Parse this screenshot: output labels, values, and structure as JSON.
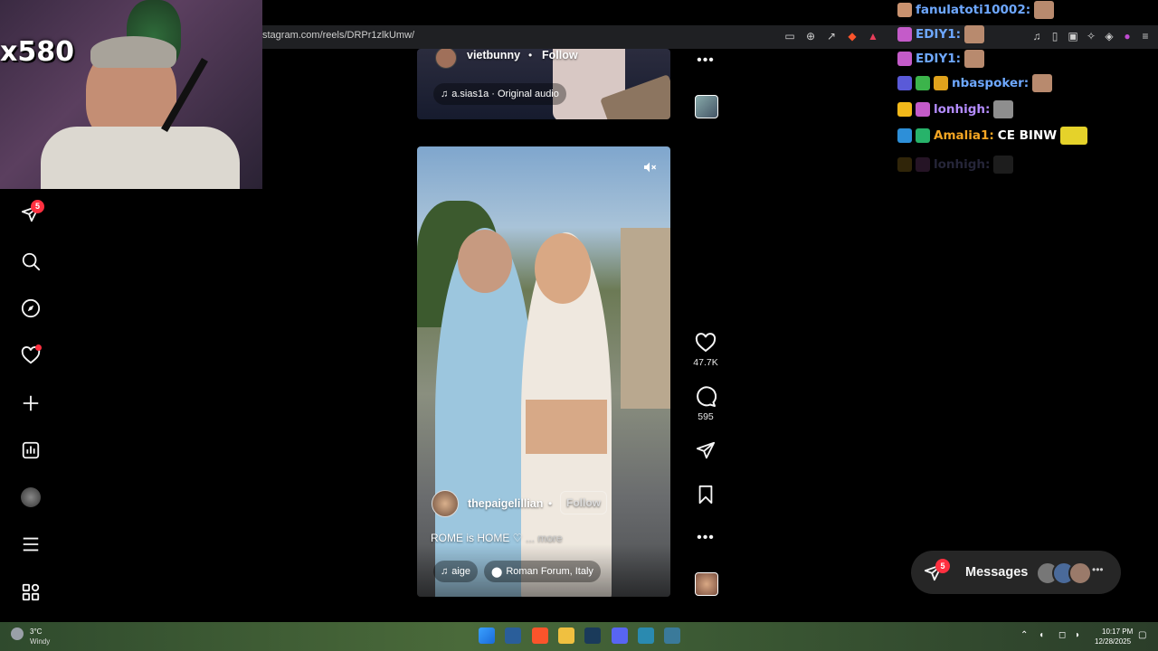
{
  "browser": {
    "url": "stagram.com/reels/DRPr1zlkUmw/"
  },
  "webcam": {
    "overlay_text": "x580"
  },
  "nav": {
    "direct_badge": "5"
  },
  "reel_top": {
    "username": "vietbunny",
    "follow_label": "Follow",
    "audio": "a.sias1a · Original audio"
  },
  "reel_main": {
    "username": "thepaigelillian",
    "follow_label": "Follow",
    "caption": "ROME is HOME ♡",
    "more_label": "... more",
    "audio": "aige",
    "location": "Roman Forum, Italy",
    "likes": "47.7K",
    "comments": "595"
  },
  "chat": [
    {
      "user": "fanulatoti10002:",
      "color": "#6ea8ff"
    },
    {
      "user": "EDIY1:",
      "color": "#6ea8ff"
    },
    {
      "user": "EDIY1:",
      "color": "#6ea8ff"
    },
    {
      "user": "nbaspoker:",
      "color": "#6ea8ff"
    },
    {
      "user": "lonhigh:",
      "color": "#b48cff"
    },
    {
      "user": "Amalia1:",
      "color": "#f5a623",
      "message": "CE BINW"
    },
    {
      "user": "lonhigh:",
      "color": "#3a3a55"
    }
  ],
  "messages": {
    "label": "Messages",
    "badge": "5"
  },
  "taskbar": {
    "weather_temp": "3°C",
    "weather_desc": "Windy",
    "time": "10:17 PM",
    "date": "12/28/2025"
  }
}
